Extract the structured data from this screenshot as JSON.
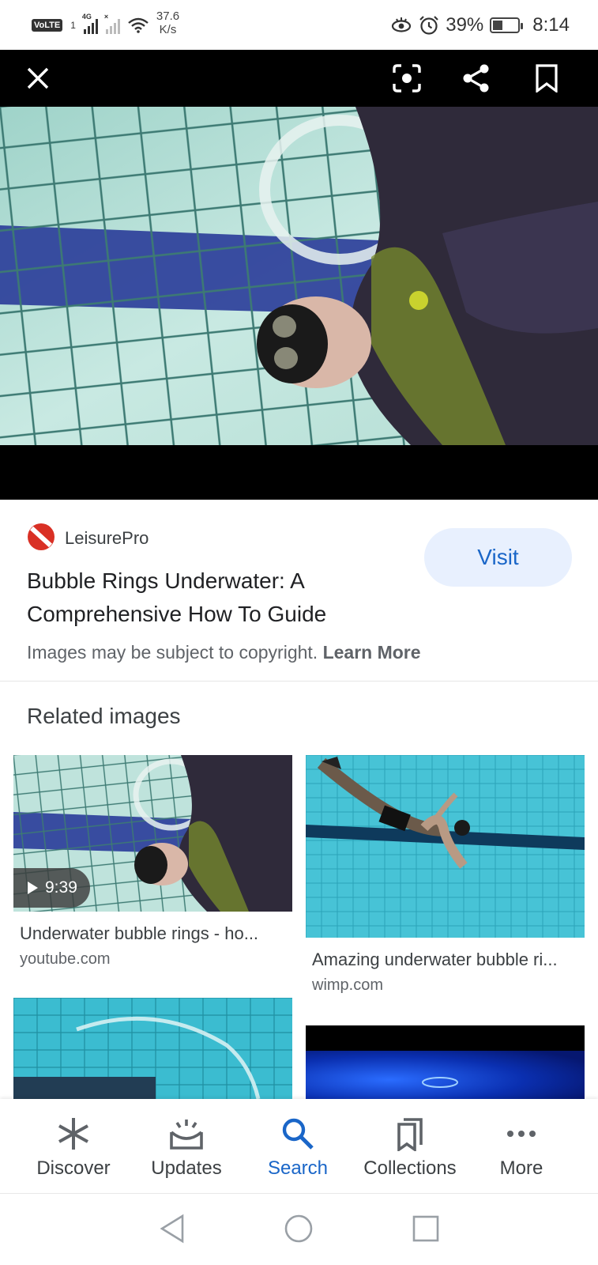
{
  "status_bar": {
    "volte": "VoLTE",
    "network": "4G",
    "speed_value": "37.6",
    "speed_unit": "K/s",
    "battery": "39%",
    "battery_level": 0.39,
    "time": "8:14"
  },
  "viewer": {
    "close_icon": "close-icon",
    "lens_icon": "lens-icon",
    "share_icon": "share-icon",
    "bookmark_icon": "bookmark-icon"
  },
  "source": {
    "name": "LeisurePro",
    "title": "Bubble Rings Underwater: A Comprehensive How To Guide",
    "visit_label": "Visit",
    "copyright_text": "Images may be subject to copyright.",
    "learn_more": "Learn More",
    "brand_color": "#d93025"
  },
  "related": {
    "heading": "Related images",
    "items": [
      {
        "title": "Underwater bubble rings - ho...",
        "domain": "youtube.com",
        "duration": "9:39"
      },
      {
        "title": "Amazing underwater bubble ri...",
        "domain": "wimp.com"
      }
    ]
  },
  "bottom_nav": {
    "items": [
      {
        "label": "Discover",
        "icon": "asterisk-icon"
      },
      {
        "label": "Updates",
        "icon": "updates-icon"
      },
      {
        "label": "Search",
        "icon": "search-icon"
      },
      {
        "label": "Collections",
        "icon": "collections-icon"
      },
      {
        "label": "More",
        "icon": "more-icon"
      }
    ],
    "active": "Search",
    "accent": "#1a66c8"
  },
  "system_nav": {
    "back": "back-icon",
    "home": "home-icon",
    "recents": "recents-icon"
  }
}
